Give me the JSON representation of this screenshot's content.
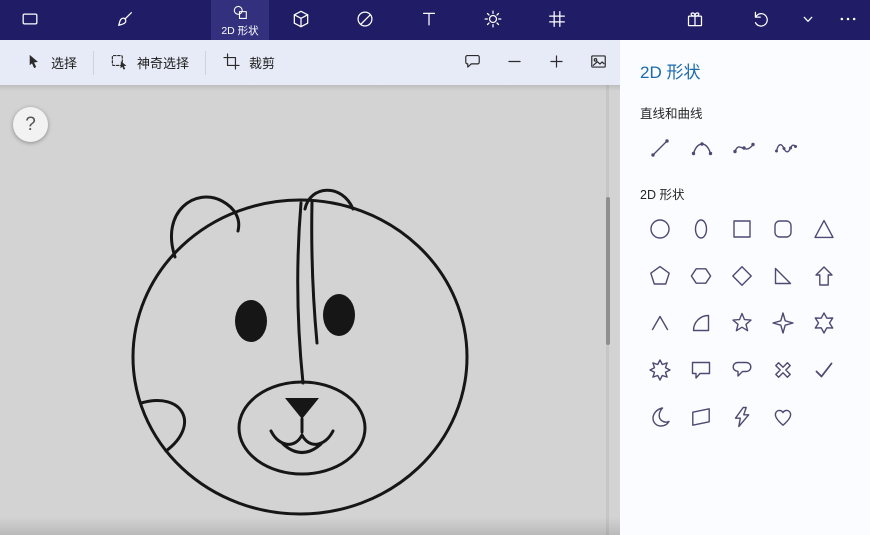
{
  "colors": {
    "topbar_bg": "#201d66",
    "topbar_selected_bg": "#33307e",
    "toolbar_bg": "#e7ebf7",
    "canvas_bg": "#d3d3d3",
    "panel_bg": "#fbfcff",
    "accent": "#1a6aad",
    "icon_ink": "#4c4a72",
    "drawing_ink": "#161616"
  },
  "topbar": {
    "tabs": [
      {
        "id": "menu",
        "icon": "window"
      },
      {
        "id": "brushes",
        "icon": "brush"
      },
      {
        "id": "shapes-2d",
        "icon": "shapes-2d",
        "label": "2D 形状",
        "selected": true
      },
      {
        "id": "shapes-3d",
        "icon": "cube"
      },
      {
        "id": "stickers",
        "icon": "sticker"
      },
      {
        "id": "text",
        "icon": "text"
      },
      {
        "id": "effects",
        "icon": "sun"
      },
      {
        "id": "canvas",
        "icon": "canvas-grid"
      }
    ],
    "right": [
      {
        "id": "library",
        "icon": "gift"
      },
      {
        "id": "undo",
        "icon": "undo"
      },
      {
        "id": "dropdown",
        "icon": "chevron-down"
      },
      {
        "id": "more",
        "icon": "ellipsis"
      }
    ]
  },
  "toolbar": {
    "select_label": "选择",
    "magic_select_label": "神奇选择",
    "crop_label": "裁剪"
  },
  "canvas": {
    "help_label": "?",
    "drawing": "hamster-face-line-art"
  },
  "panel": {
    "title": "2D 形状",
    "lines_section": "直线和曲线",
    "shapes_section": "2D 形状",
    "line_tools": [
      "line",
      "curve",
      "s-curve",
      "wave"
    ],
    "shapes": [
      "circle",
      "ellipse",
      "square",
      "rounded-square",
      "triangle",
      "pentagon",
      "hexagon",
      "diamond",
      "right-triangle",
      "block-arrow-up",
      "chevron",
      "quarter-circle",
      "star-5",
      "star-4",
      "star-6",
      "burst",
      "speech-rectangle",
      "speech-round",
      "cross",
      "check",
      "crescent",
      "banner",
      "lightning",
      "heart"
    ]
  }
}
